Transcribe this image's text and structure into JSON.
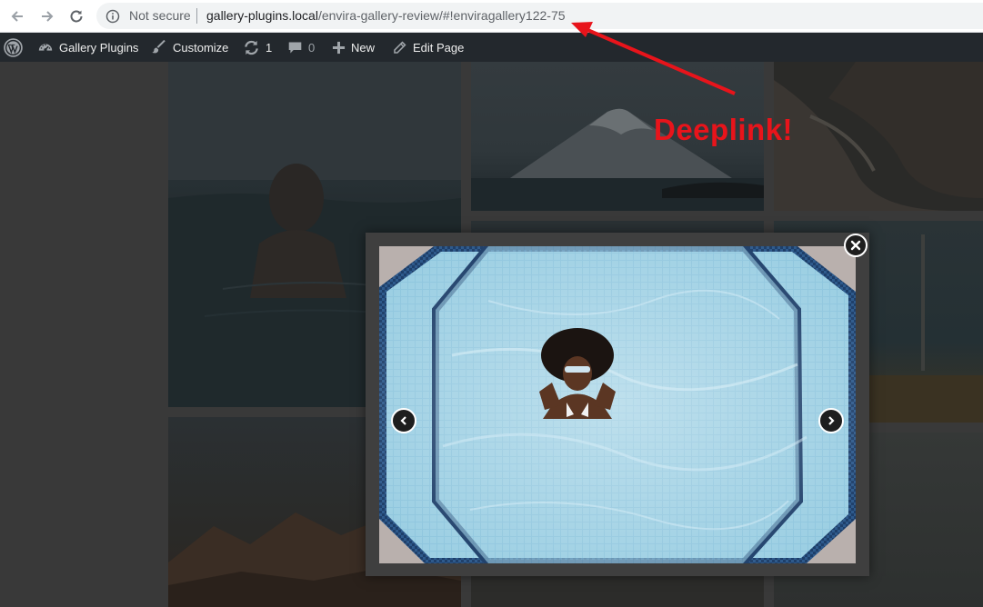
{
  "browser": {
    "security_label": "Not secure",
    "url_host": "gallery-plugins.local",
    "url_path": "/envira-gallery-review/#!enviragallery122-75",
    "icons": {
      "back": "back-arrow-icon",
      "forward": "forward-arrow-icon",
      "reload": "reload-icon",
      "info": "info-icon"
    }
  },
  "admin_bar": {
    "site_name": "Gallery Plugins",
    "customize": "Customize",
    "updates_count": "1",
    "comments_count": "0",
    "new_label": "New",
    "edit_label": "Edit Page"
  },
  "annotation": {
    "text": "Deeplink!",
    "color": "#e8141b"
  },
  "lightbox": {
    "icons": {
      "close": "close-icon",
      "prev": "chevron-left-icon",
      "next": "chevron-right-icon"
    }
  },
  "colors": {
    "admin_bar": "#23282d",
    "page_bg": "#393939",
    "lightbox_frame": "#3f3f3f"
  }
}
